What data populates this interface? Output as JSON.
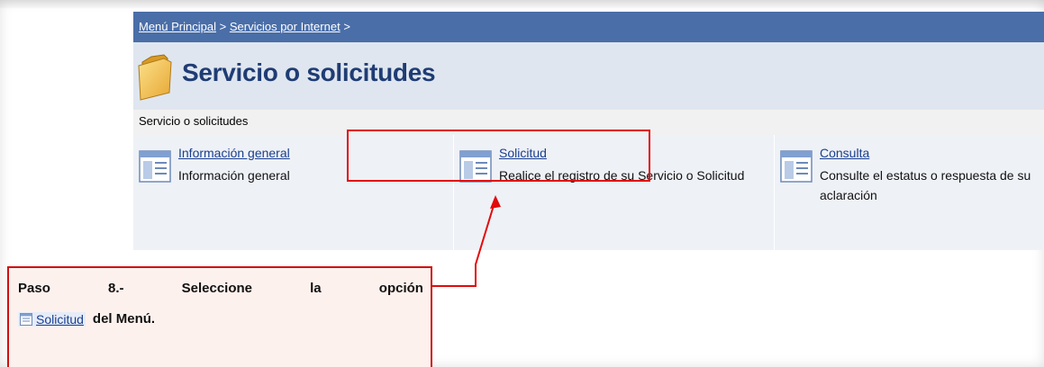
{
  "breadcrumb": {
    "items": [
      "Menú Principal",
      "Servicios por Internet"
    ],
    "separator": ">"
  },
  "header": {
    "title": "Servicio o solicitudes",
    "icon": "folder-icon"
  },
  "subheader": {
    "label": "Servicio o solicitudes"
  },
  "cards": [
    {
      "icon": "document-icon",
      "title": "Información general",
      "description": "Información general"
    },
    {
      "icon": "document-icon",
      "title": "Solicitud",
      "description": "Realice el registro de su Servicio o Solicitud"
    },
    {
      "icon": "document-icon",
      "title": "Consulta",
      "description": "Consulte el estatus o respuesta de su aclaración"
    }
  ],
  "instruction": {
    "paso": "Paso",
    "numero": "8.-",
    "seleccione": "Seleccione",
    "la": "la",
    "opcion": "opción",
    "link_label": "Solicitud",
    "tail": "del Menú."
  },
  "colors": {
    "topbar": "#4a6ea8",
    "header_bg": "#dfe6ef",
    "title": "#1f3c74",
    "link": "#1a3f8f",
    "callout": "#e20a0a"
  }
}
